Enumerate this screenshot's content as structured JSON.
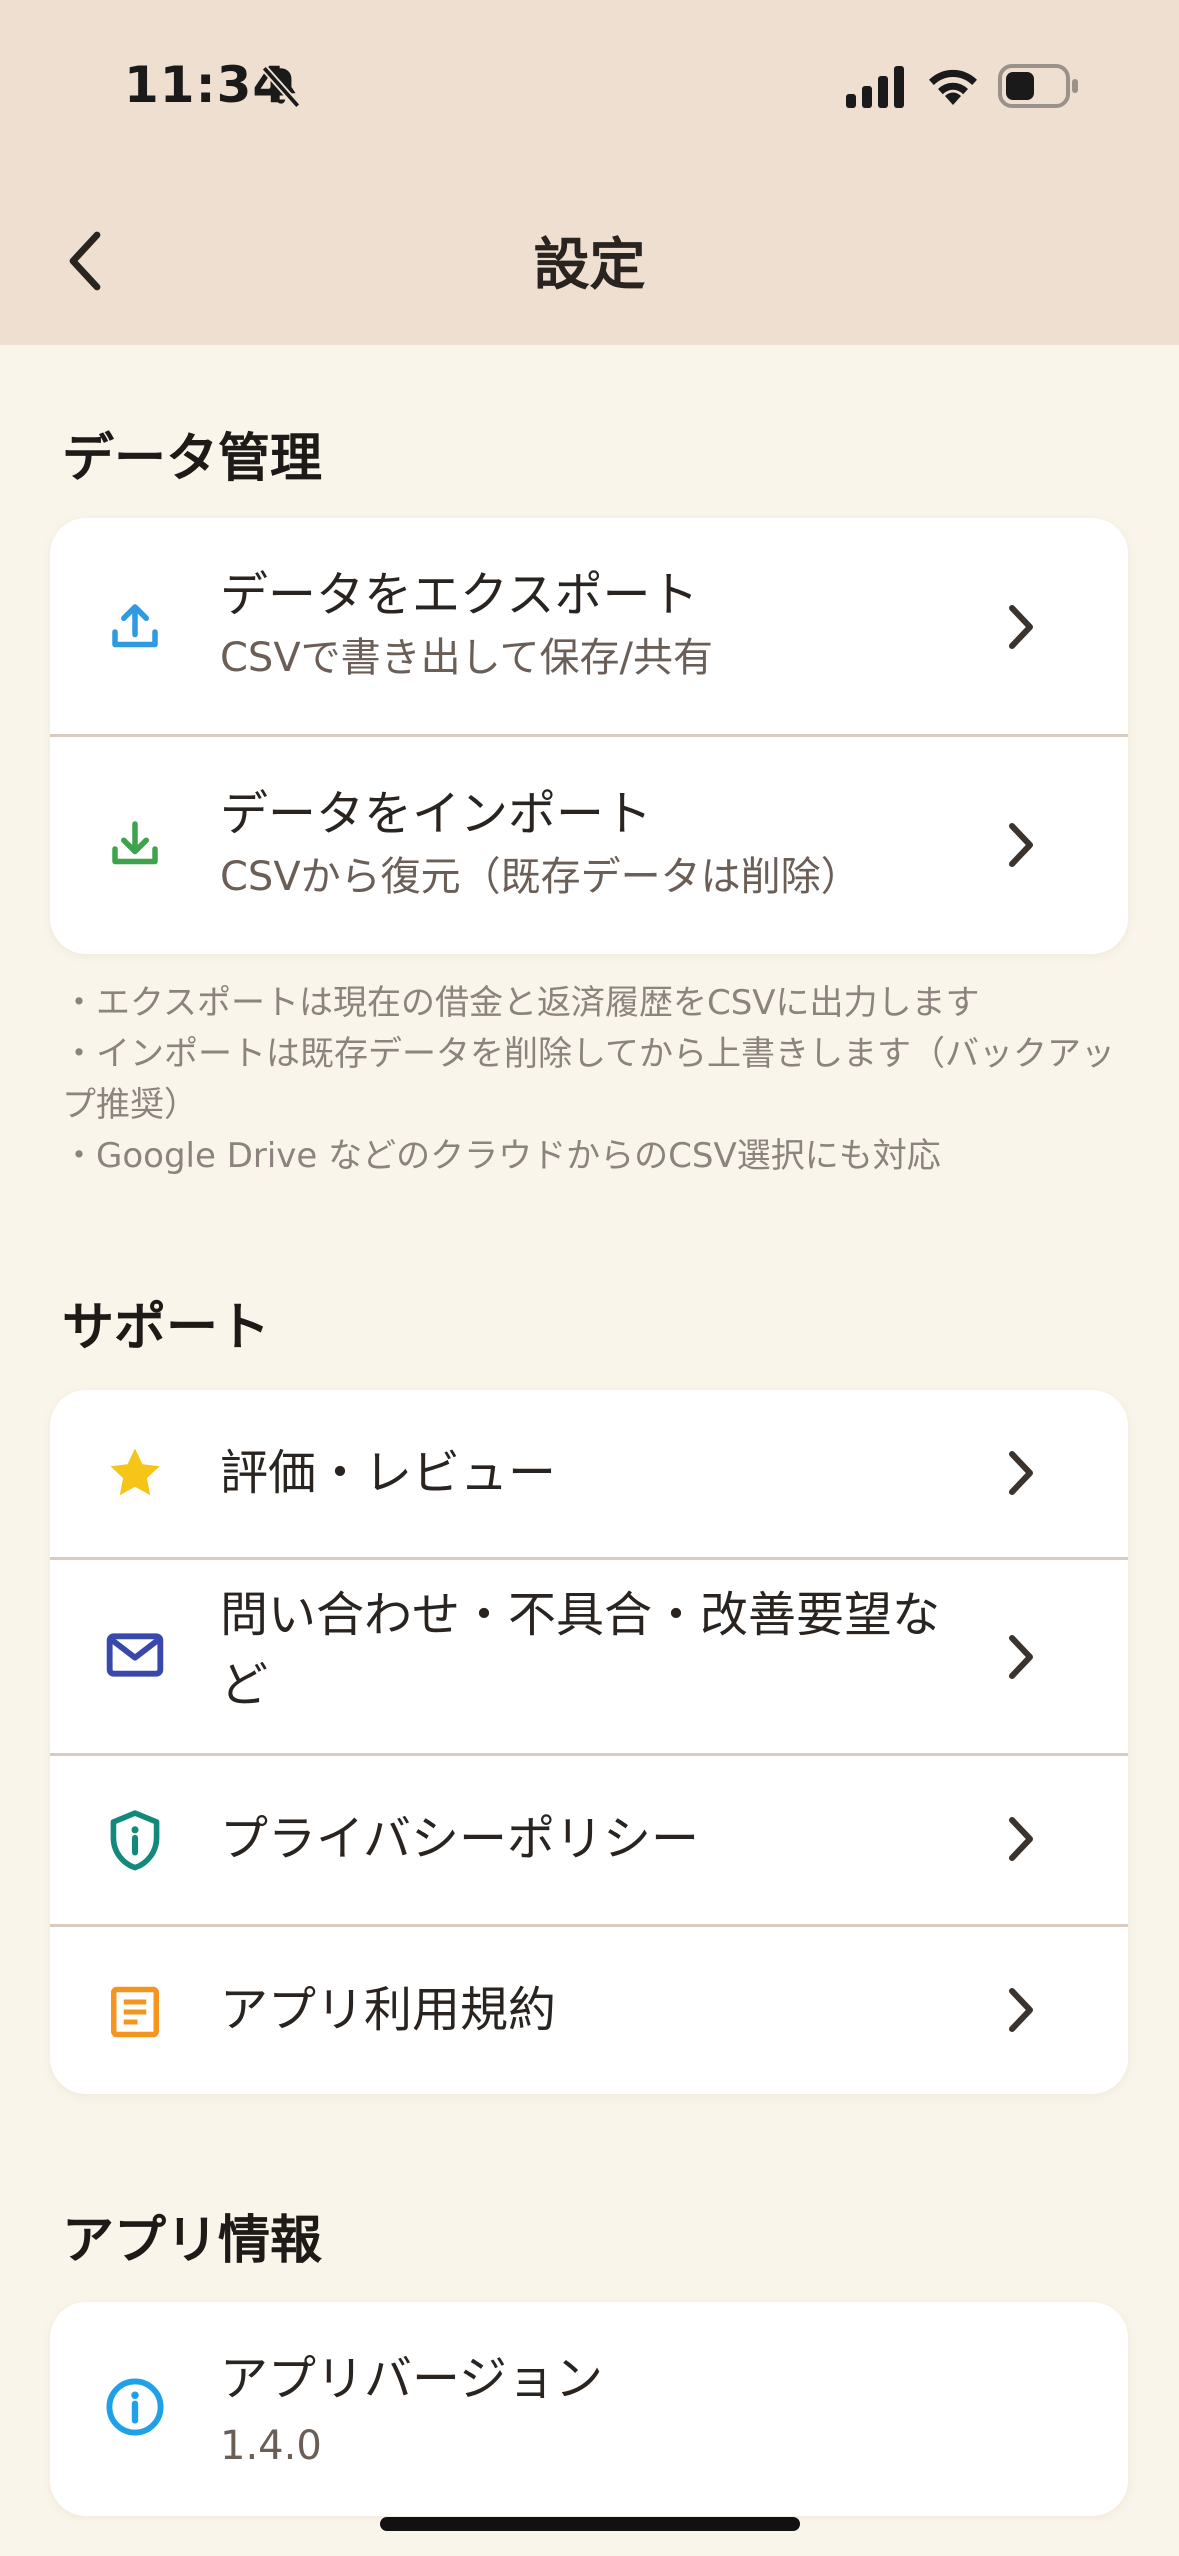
{
  "status_bar": {
    "time": "11:34",
    "icons": [
      "bell-slash-icon",
      "cellular-signal-icon",
      "wifi-icon",
      "battery-icon"
    ]
  },
  "nav": {
    "title": "設定",
    "back_icon": "chevron-left-icon"
  },
  "sections": {
    "data": {
      "title": "データ管理",
      "items": [
        {
          "icon": "upload-icon",
          "title": "データをエクスポート",
          "subtitle": "CSVで書き出して保存/共有"
        },
        {
          "icon": "download-icon",
          "title": "データをインポート",
          "subtitle": "CSVから復元（既存データは削除）"
        }
      ],
      "notes": [
        "・エクスポートは現在の借金と返済履歴をCSVに出力します",
        "・インポートは既存データを削除してから上書きします（バックアップ推奨）",
        "・Google Drive などのクラウドからのCSV選択にも対応"
      ]
    },
    "support": {
      "title": "サポート",
      "items": [
        {
          "icon": "star-icon",
          "title": "評価・レビュー"
        },
        {
          "icon": "mail-icon",
          "title": "問い合わせ・不具合・改善要望など"
        },
        {
          "icon": "shield-info-icon",
          "title": "プライバシーポリシー"
        },
        {
          "icon": "document-icon",
          "title": "アプリ利用規約"
        }
      ]
    },
    "app_info": {
      "title": "アプリ情報",
      "items": [
        {
          "icon": "info-icon",
          "title": "アプリバージョン",
          "value": "1.4.0"
        }
      ]
    }
  },
  "colors": {
    "header_bg": "#EFDFD1",
    "page_bg": "#FAF5EA",
    "upload": "#2E9BE0",
    "download": "#3FA34D",
    "star": "#F5C518",
    "mail": "#3949AB",
    "shield": "#12897A",
    "document": "#F5941E",
    "info": "#1EA1E6"
  }
}
